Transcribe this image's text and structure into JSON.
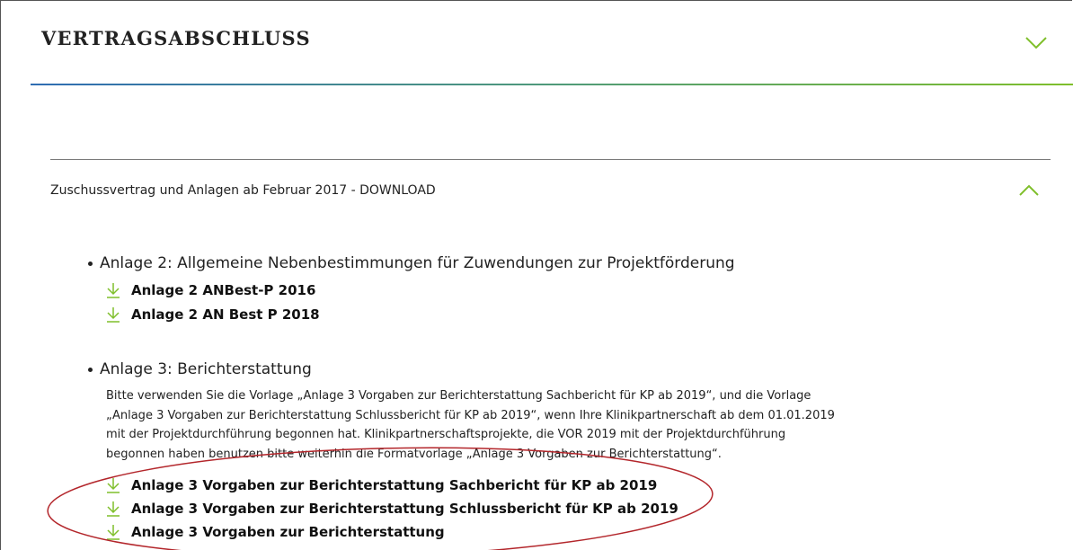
{
  "page_title": "VERTRAGSABSCHLUSS",
  "accordion": {
    "label": "Zuschussvertrag und Anlagen ab Februar 2017 - DOWNLOAD"
  },
  "sections": [
    {
      "title": "Anlage 2: Allgemeine Nebenbestimmungen für Zuwendungen zur Projektförderung",
      "downloads": [
        "Anlage 2 ANBest-P 2016",
        "Anlage 2 AN Best P 2018"
      ]
    },
    {
      "title": "Anlage 3: Berichterstattung",
      "description_lines": [
        "Bitte verwenden Sie die Vorlage „Anlage 3 Vorgaben zur Berichterstattung Sachbericht für KP ab 2019“, und die Vorlage",
        "„Anlage 3 Vorgaben zur Berichterstattung Schlussbericht für KP ab 2019“, wenn Ihre Klinikpartnerschaft ab dem 01.01.2019",
        "mit der Projektdurchführung begonnen hat. Klinikpartnerschaftsprojekte, die VOR 2019 mit der Projektdurchführung",
        "begonnen haben benutzen bitte weiterhin die Formatvorlage „Anlage 3 Vorgaben zur Berichterstattung“."
      ],
      "downloads": [
        "Anlage 3 Vorgaben zur Berichterstattung Sachbericht für KP ab 2019",
        "Anlage 3 Vorgaben zur Berichterstattung Schlussbericht für KP ab 2019",
        "Anlage 3 Vorgaben zur Berichterstattung"
      ]
    }
  ],
  "icons": {
    "expand": "chevron-down-icon",
    "collapse": "chevron-up-icon",
    "download": "download-arrow-icon"
  },
  "colors": {
    "accent_green": "#7fbf2b",
    "accent_blue": "#2f6db3",
    "annotation_red": "#b3262b"
  }
}
